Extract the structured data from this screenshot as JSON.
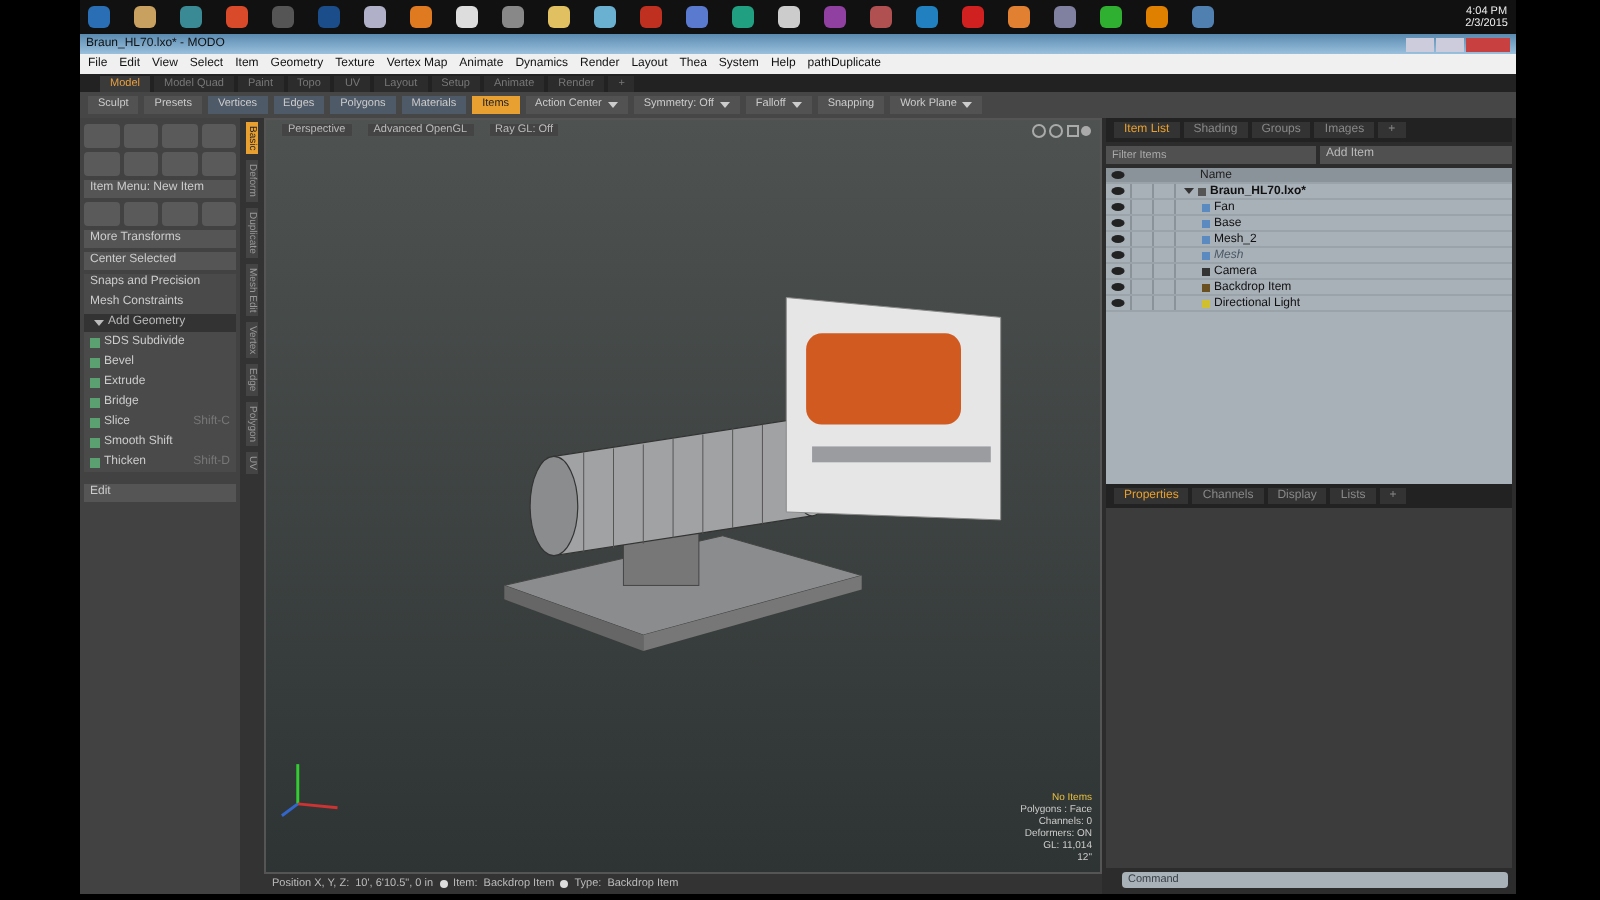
{
  "taskbar": {
    "apps": [
      {
        "color": "#2a6fb5"
      },
      {
        "color": "#c8a060"
      },
      {
        "color": "#3a8a96"
      },
      {
        "color": "#d84a2a"
      },
      {
        "color": "#555555"
      },
      {
        "color": "#1b4d8a"
      },
      {
        "color": "#b0b0c8"
      },
      {
        "color": "#e07a20"
      },
      {
        "color": "#dddddd"
      },
      {
        "color": "#888888"
      },
      {
        "color": "#e0c060"
      },
      {
        "color": "#6ab0d0"
      },
      {
        "color": "#c03020"
      },
      {
        "color": "#5a7ad0"
      },
      {
        "color": "#20a080"
      },
      {
        "color": "#cccccc"
      },
      {
        "color": "#9040a0"
      },
      {
        "color": "#b05050"
      },
      {
        "color": "#2080c0"
      },
      {
        "color": "#d02020"
      },
      {
        "color": "#e08030"
      },
      {
        "color": "#8080a0"
      },
      {
        "color": "#30b030"
      },
      {
        "color": "#e08000"
      },
      {
        "color": "#5080b0"
      }
    ],
    "clock": {
      "time": "4:04 PM",
      "date": "2/3/2015"
    }
  },
  "window": {
    "title": "Braun_HL70.lxo* - MODO"
  },
  "menu": [
    "File",
    "Edit",
    "View",
    "Select",
    "Item",
    "Geometry",
    "Texture",
    "Vertex Map",
    "Animate",
    "Dynamics",
    "Render",
    "Layout",
    "Thea",
    "System",
    "Help",
    "pathDuplicate"
  ],
  "layout_tabs": [
    {
      "label": "Model",
      "selected": true
    },
    {
      "label": "Model Quad",
      "selected": false
    },
    {
      "label": "Paint",
      "selected": false
    },
    {
      "label": "Topo",
      "selected": false
    },
    {
      "label": "UV",
      "selected": false
    },
    {
      "label": "Layout",
      "selected": false
    },
    {
      "label": "Setup",
      "selected": false
    },
    {
      "label": "Animate",
      "selected": false
    },
    {
      "label": "Render",
      "selected": false
    },
    {
      "label": "+",
      "selected": false
    }
  ],
  "toolbar": [
    {
      "label": "Sculpt",
      "kind": "button",
      "selected": false
    },
    {
      "label": "Presets",
      "kind": "button",
      "selected": false
    },
    {
      "label": "Vertices",
      "kind": "mode",
      "selected": false
    },
    {
      "label": "Edges",
      "kind": "mode",
      "selected": false
    },
    {
      "label": "Polygons",
      "kind": "mode",
      "selected": false
    },
    {
      "label": "Materials",
      "kind": "mode",
      "selected": false
    },
    {
      "label": "Items",
      "kind": "mode",
      "selected": true
    },
    {
      "label": "Action Center",
      "kind": "dropdown",
      "selected": false
    },
    {
      "label": "Symmetry: Off",
      "kind": "dropdown",
      "selected": false
    },
    {
      "label": "Falloff",
      "kind": "dropdown",
      "selected": false
    },
    {
      "label": "Snapping",
      "kind": "button",
      "selected": false
    },
    {
      "label": "Work Plane",
      "kind": "dropdown",
      "selected": false
    }
  ],
  "toolbox": {
    "item_menu": "Item Menu: New Item",
    "transforms": [
      "More Transforms",
      "Center Selected"
    ],
    "tools": [
      "Snaps and Precision",
      "Mesh Constraints"
    ],
    "add_geometry": {
      "label": "Add Geometry",
      "expanded": true
    },
    "geometry_tools": [
      {
        "label": "SDS Subdivide"
      },
      {
        "label": "Bevel"
      },
      {
        "label": "Extrude"
      },
      {
        "label": "Bridge"
      },
      {
        "label": "Slice",
        "shortcut": "Shift-C"
      },
      {
        "label": "Smooth Shift"
      },
      {
        "label": "Thicken",
        "shortcut": "Shift-D"
      }
    ],
    "edit_menu": "Edit"
  },
  "side_tabs": [
    {
      "label": "Basic",
      "selected": true
    },
    {
      "label": "Deform",
      "selected": false
    },
    {
      "label": "Duplicate",
      "selected": false
    },
    {
      "label": "Mesh Edit",
      "selected": false
    },
    {
      "label": "Vertex",
      "selected": false
    },
    {
      "label": "Edge",
      "selected": false
    },
    {
      "label": "Polygon",
      "selected": false
    },
    {
      "label": "UV",
      "selected": false
    }
  ],
  "viewport": {
    "header": [
      "Perspective",
      "Advanced OpenGL",
      "Ray GL: Off"
    ],
    "info": [
      {
        "text": "No Items",
        "kind": "title"
      },
      {
        "text": "Polygons : Face",
        "kind": "stat"
      },
      {
        "text": "Channels: 0",
        "kind": "stat"
      },
      {
        "text": "Deformers: ON",
        "kind": "stat"
      },
      {
        "text": "GL: 11,014",
        "kind": "stat"
      },
      {
        "text": "12\"",
        "kind": "stat"
      }
    ]
  },
  "status_bar": [
    {
      "label": "Position X, Y, Z:",
      "value": "10', 6'10.5\", 0 in"
    },
    {
      "label": "Item:",
      "value": "Backdrop Item"
    },
    {
      "label": "Type:",
      "value": "Backdrop Item"
    }
  ],
  "item_list": {
    "tabs": [
      {
        "label": "Item List",
        "selected": true
      },
      {
        "label": "Shading",
        "selected": false
      },
      {
        "label": "Groups",
        "selected": false
      },
      {
        "label": "Images",
        "selected": false
      },
      {
        "label": "+",
        "selected": false
      }
    ],
    "filter": {
      "placeholder": "Filter Items"
    },
    "add_item": "Add Item",
    "name_column": "Name",
    "tree": [
      {
        "label": "Braun_HL70.lxo*",
        "kind": "scene",
        "expanded": true,
        "dimmed": false,
        "children": [
          {
            "label": "Fan",
            "kind": "mesh",
            "dimmed": false
          },
          {
            "label": "Base",
            "kind": "mesh",
            "dimmed": false
          },
          {
            "label": "Mesh_2",
            "kind": "mesh",
            "dimmed": false
          },
          {
            "label": "Mesh",
            "kind": "mesh",
            "dimmed": true
          },
          {
            "label": "Camera",
            "kind": "camera",
            "dimmed": false
          },
          {
            "label": "Backdrop Item",
            "kind": "backdrop",
            "dimmed": false
          },
          {
            "label": "Directional Light",
            "kind": "light",
            "dimmed": false
          }
        ]
      }
    ]
  },
  "properties": {
    "tabs": [
      {
        "label": "Properties",
        "selected": true
      },
      {
        "label": "Channels",
        "selected": false
      },
      {
        "label": "Display",
        "selected": false
      },
      {
        "label": "Lists",
        "selected": false
      },
      {
        "label": "+",
        "selected": false
      }
    ],
    "command": {
      "placeholder": "Command"
    }
  }
}
